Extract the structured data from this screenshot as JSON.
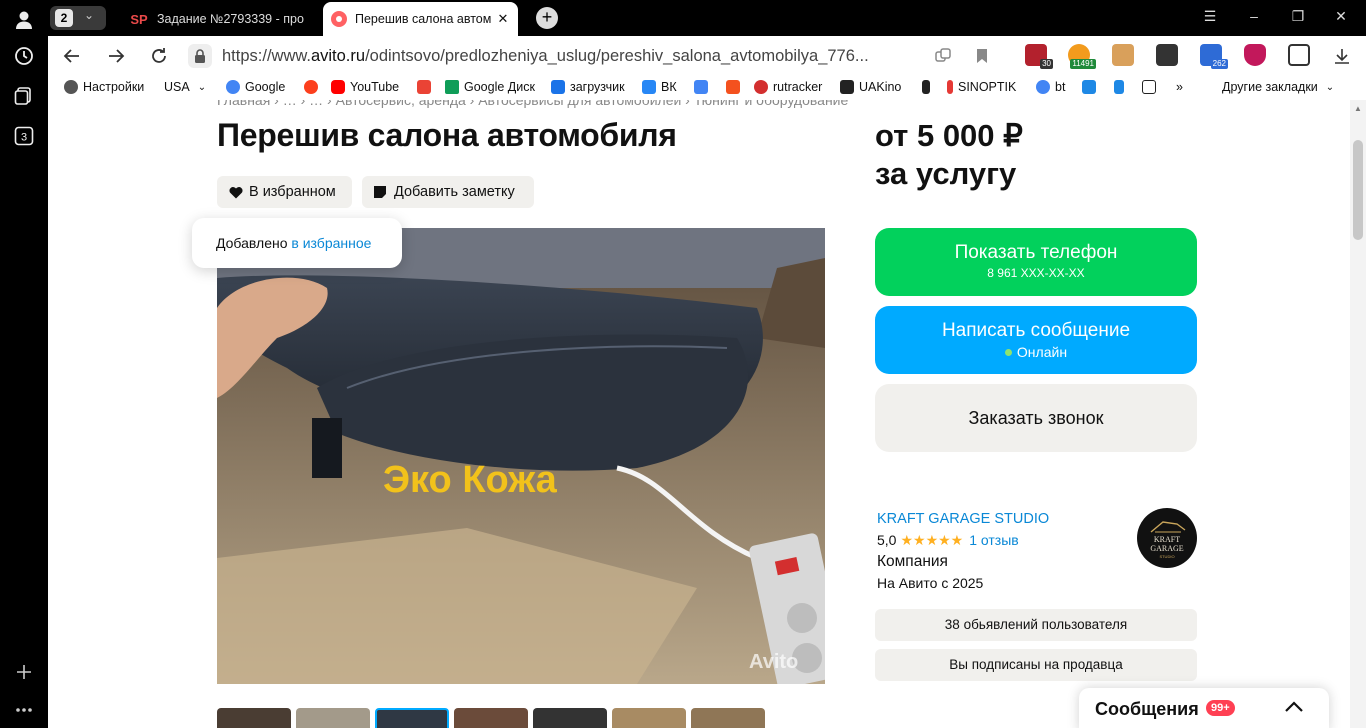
{
  "browser": {
    "tab_count": "2",
    "tabs": [
      {
        "title": "Задание №2793339 - про",
        "favicon": "SP"
      },
      {
        "title": "Перешив салона автом",
        "favicon": "avito-dot"
      }
    ],
    "url_prefix": "https://www.",
    "url_domain": "avito.ru",
    "url_path": "/odintsovo/predlozheniya_uslug/pereshiv_salona_avtomobilya_776...",
    "extensions": [
      {
        "name": "shield-ext",
        "badge": "30",
        "color": "#b3212d"
      },
      {
        "name": "sticker-ext",
        "badge": "11491",
        "color": "#f29b1d"
      },
      {
        "name": "bag-ext",
        "badge": "",
        "color": "#d9a05b"
      },
      {
        "name": "split-ext",
        "badge": "",
        "color": "#333333"
      },
      {
        "name": "calendar-ext",
        "badge": "262",
        "color": "#2e6bd6"
      },
      {
        "name": "ublock-ext",
        "badge": "",
        "color": "#c2185b"
      },
      {
        "name": "puzzle-ext",
        "badge": "",
        "color": "#333333"
      },
      {
        "name": "download-ext",
        "badge": "",
        "color": "#333333"
      }
    ],
    "bookmarks": [
      {
        "label": "Настройки",
        "icon": "gear",
        "color": "#333333"
      },
      {
        "label": "USA",
        "icon": "dropdown",
        "color": "#333333"
      },
      {
        "label": "Google",
        "icon": "google",
        "color": "#4285f4"
      },
      {
        "label": "",
        "icon": "yandex",
        "color": "#fc3f1d"
      },
      {
        "label": "YouTube",
        "icon": "youtube",
        "color": "#ff0000"
      },
      {
        "label": "",
        "icon": "gmail",
        "color": "#ea4335"
      },
      {
        "label": "Google Диск",
        "icon": "gdrive",
        "color": "#0f9d58"
      },
      {
        "label": "загрузчик",
        "icon": "loop",
        "color": "#1a73e8"
      },
      {
        "label": "ВК",
        "icon": "play",
        "color": "#2787f5"
      },
      {
        "label": "",
        "icon": "translate",
        "color": "#4285f4"
      },
      {
        "label": "",
        "icon": "f-square",
        "color": "#f4511e"
      },
      {
        "label": "rutracker",
        "icon": "flower",
        "color": "#d32f2f"
      },
      {
        "label": "UAKino",
        "icon": "uakino",
        "color": "#222222"
      },
      {
        "label": "",
        "icon": "chess",
        "color": "#222222"
      },
      {
        "label": "SINOPTIK",
        "icon": "thermo",
        "color": "#e53935"
      },
      {
        "label": "bt",
        "icon": "google",
        "color": "#4285f4"
      },
      {
        "label": "",
        "icon": "p-square",
        "color": "#1e88e5"
      },
      {
        "label": "",
        "icon": "chevron",
        "color": "#1e88e5"
      },
      {
        "label": "",
        "icon": "bc",
        "color": "#222222"
      },
      {
        "label": "»",
        "icon": "none",
        "color": "#333333"
      }
    ],
    "other_bookmarks": "Другие закладки"
  },
  "page": {
    "breadcrumbs": "Главная › … › … › Автосервис, аренда › Автосервисы для автомобилей › Тюнинг и оборудование",
    "title": "Перешив салона автомобиля",
    "fav_button": "В избранном",
    "note_button": "Добавить заметку",
    "toast_text": "Добавлено ",
    "toast_link": "в избранное",
    "photo_caption": "Эко Кожа",
    "watermark": "Avito",
    "price_line1": "от 5 000 ₽",
    "price_line2": "за услугу",
    "phone_button": "Показать телефон",
    "phone_number": "8 961 XXX-XX-XX",
    "message_button": "Написать сообщение",
    "online_status": "Онлайн",
    "callback_button": "Заказать звонок",
    "seller_name": "KRAFT GARAGE STUDIO",
    "seller_rating": "5,0",
    "seller_stars": "★★★★★",
    "seller_reviews": "1 отзыв",
    "seller_type": "Компания",
    "seller_since": "На Авито с 2025",
    "avatar_text_1": "KRAFT",
    "avatar_text_2": "GARAGE",
    "avatar_text_3": "STUDIO",
    "listings_button": "38 обьявлений пользователя",
    "subscribed_button": "Вы подписаны на продавца",
    "messages_label": "Сообщения",
    "messages_count": "99+"
  },
  "colors": {
    "avito_green": "#02d15c",
    "avito_blue": "#00aaff",
    "link_blue": "#0a88d6",
    "gray_btn": "#f1f0ed",
    "badge_red": "#ff4053"
  }
}
